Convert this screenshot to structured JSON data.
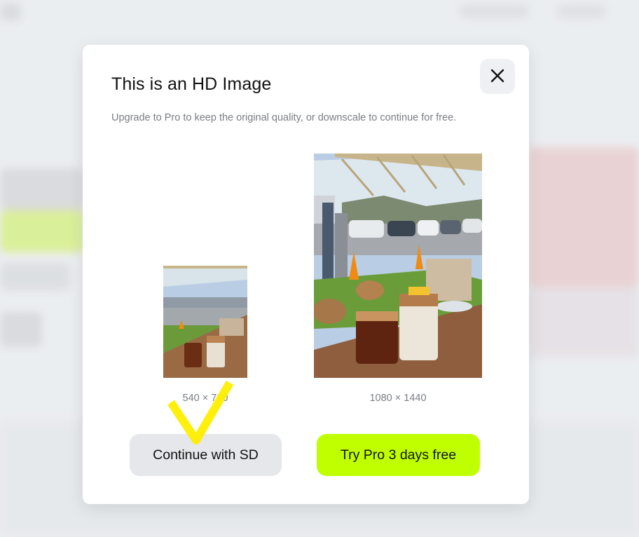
{
  "modal": {
    "title": "This is an HD Image",
    "subtitle": "Upgrade to Pro to keep the original quality, or downscale to continue for free.",
    "close_icon": "close-icon"
  },
  "previews": {
    "sd": {
      "dimensions": "540 × 720"
    },
    "hd": {
      "dimensions": "1080 × 1440"
    }
  },
  "buttons": {
    "continue_sd": "Continue with SD",
    "try_pro": "Try Pro 3 days free"
  },
  "colors": {
    "accent": "#bfff00",
    "secondary_button": "#e6e7eb",
    "annotation": "#ffee00"
  },
  "annotation": {
    "icon": "checkmark-annotation"
  }
}
